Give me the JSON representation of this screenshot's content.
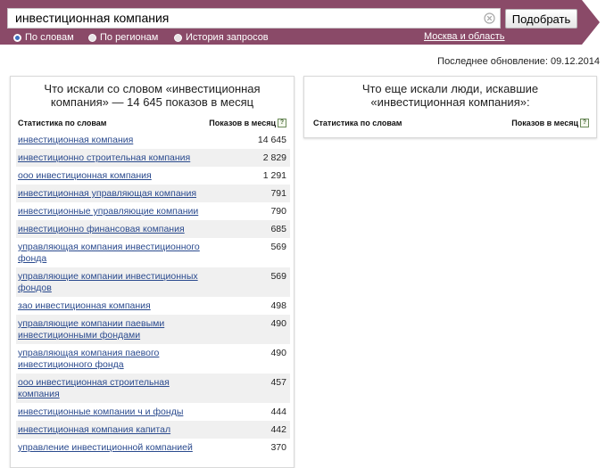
{
  "search": {
    "value": "инвестиционная компания",
    "submit_label": "Подобрать"
  },
  "modes": [
    {
      "label": "По словам",
      "checked": true
    },
    {
      "label": "По регионам",
      "checked": false
    },
    {
      "label": "История запросов",
      "checked": false
    }
  ],
  "region_label": "Москва и область",
  "last_updated": "Последнее обновление: 09.12.2014",
  "left_panel": {
    "title_line1": "Что искали со словом «инвестиционная",
    "title_line2": "компания» — 14 645 показов в месяц",
    "col_words": "Статистика по словам",
    "col_shows": "Показов в месяц",
    "help": "?",
    "rows": [
      {
        "l1": "инвестиционная компания",
        "l2": "",
        "count": "14 645"
      },
      {
        "l1": "инвестиционно строительная компания",
        "l2": "",
        "count": "2 829"
      },
      {
        "l1": "ооо инвестиционная компания",
        "l2": "",
        "count": "1 291"
      },
      {
        "l1": "инвестиционная управляющая компания",
        "l2": "",
        "count": "791"
      },
      {
        "l1": "инвестиционные управляющие компании",
        "l2": "",
        "count": "790"
      },
      {
        "l1": "инвестиционно финансовая компания",
        "l2": "",
        "count": "685"
      },
      {
        "l1": "управляющая компания инвестиционного",
        "l2": "фонда",
        "count": "569"
      },
      {
        "l1": "управляющие компании инвестиционных",
        "l2": "фондов",
        "count": "569"
      },
      {
        "l1": "зао инвестиционная компания",
        "l2": "",
        "count": "498"
      },
      {
        "l1": "управляющие компании паевыми",
        "l2": "инвестиционными фондами",
        "count": "490"
      },
      {
        "l1": "управляющая компания паевого",
        "l2": "инвестиционного фонда",
        "count": "490"
      },
      {
        "l1": "ооо инвестиционная строительная",
        "l2": "компания",
        "count": "457"
      },
      {
        "l1": "инвестиционные компании ч и фонды",
        "l2": "",
        "count": "444"
      },
      {
        "l1": "инвестиционная компания капитал",
        "l2": "",
        "count": "442"
      },
      {
        "l1": "управление инвестиционной компанией",
        "l2": "",
        "count": "370"
      }
    ]
  },
  "right_panel": {
    "title_line1": "Что еще искали люди, искавшие",
    "title_line2": "«инвестиционная компания»:",
    "col_words": "Статистика по словам",
    "col_shows": "Показов в месяц",
    "help": "?"
  },
  "colors": {
    "header_bg": "#8a4a68",
    "link": "#2a4a8e"
  },
  "icons": {
    "clear": "clear-icon",
    "help": "help-icon"
  }
}
